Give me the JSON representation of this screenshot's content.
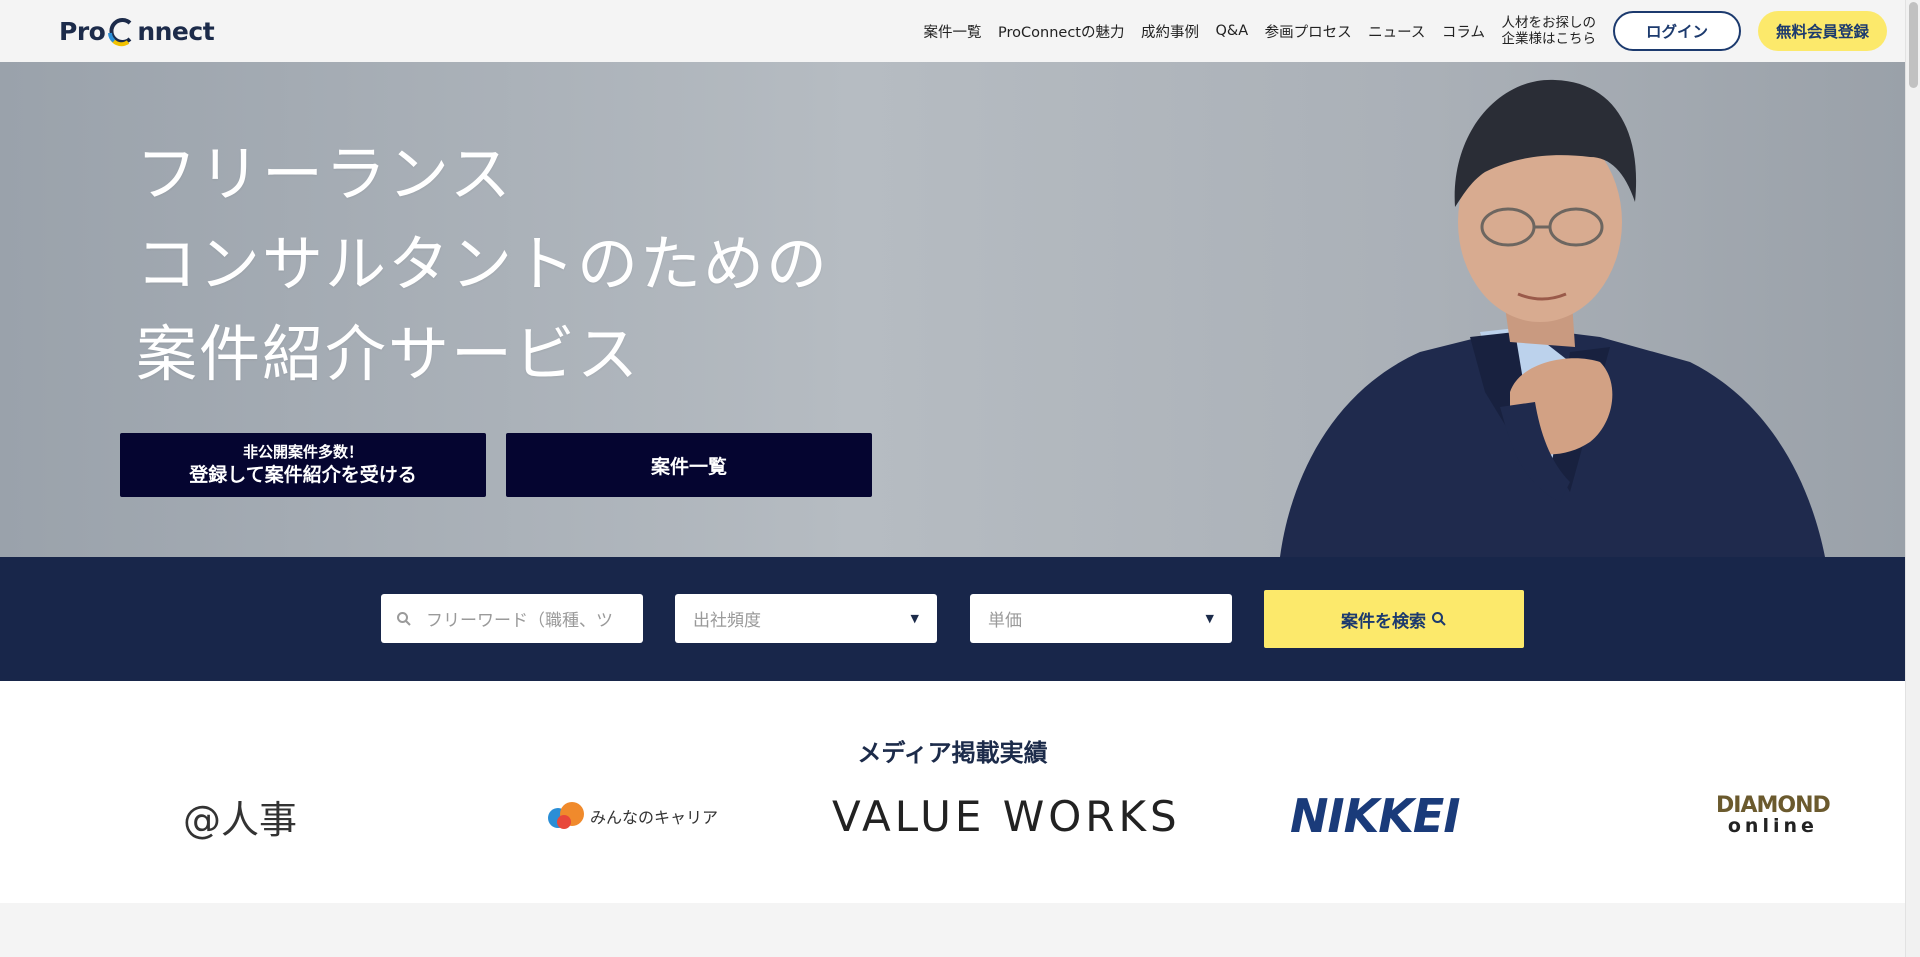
{
  "header": {
    "logo_text_left": "Pro",
    "logo_text_right": "nnect",
    "nav": [
      "案件一覧",
      "ProConnectの魅力",
      "成約事例",
      "Q&A",
      "参画プロセス",
      "ニュース",
      "コラム"
    ],
    "companies_line1": "人材をお探しの",
    "companies_line2": "企業様はこちら",
    "login": "ログイン",
    "register": "無料会員登録"
  },
  "hero": {
    "title_line1": "フリーランス",
    "title_line2": "コンサルタントのための",
    "title_line3": "案件紹介サービス",
    "register_small": "非公開案件多数！",
    "register_big": "登録して案件紹介を受ける",
    "list_button": "案件一覧"
  },
  "search": {
    "keyword_placeholder": "フリーワード（職種、ツ",
    "frequency_placeholder": "出社頻度",
    "price_placeholder": "単価",
    "search_button": "案件を検索",
    "icons": {
      "search": "search-icon",
      "chevron": "chevron-down-icon"
    }
  },
  "media": {
    "title": "メディア掲載実績",
    "logos": {
      "jinji": "@人事",
      "minna": "みんなのキャリア",
      "valueworks": "VALUE WORKS",
      "nikkei": "NIKKEI",
      "diamond_top": "DIAMOND",
      "diamond_bottom": "online"
    }
  },
  "colors": {
    "navy": "#18264a",
    "button_dark": "#050530",
    "accent_yellow": "#fce96b",
    "brand_blue": "#1c3a6e"
  }
}
